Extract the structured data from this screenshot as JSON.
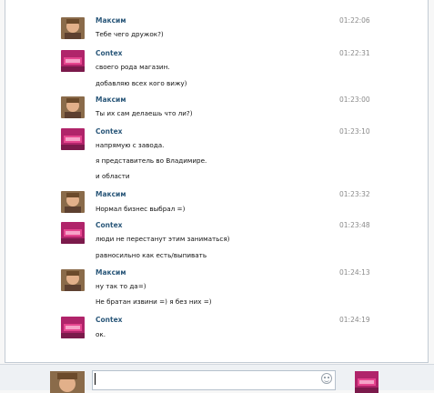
{
  "messages": [
    {
      "author": "Максим",
      "avatar": "maksim-avatar",
      "time": "01:22:06",
      "lines": [
        "Тебе чего дружок?)"
      ]
    },
    {
      "author": "Contex",
      "avatar": "contex-avatar",
      "time": "01:22:31",
      "lines": [
        "своего рода магазин.",
        "добавляю всех кого вижу)"
      ]
    },
    {
      "author": "Максим",
      "avatar": "maksim-avatar",
      "time": "01:23:00",
      "lines": [
        "Ты их сам делаешь что ли?)"
      ]
    },
    {
      "author": "Contex",
      "avatar": "contex-avatar",
      "time": "01:23:10",
      "lines": [
        "напрямую с завода.",
        "я представитель во Владимире.",
        "и области"
      ]
    },
    {
      "author": "Максим",
      "avatar": "maksim-avatar",
      "time": "01:23:32",
      "lines": [
        "Нормал бизнес выбрал =)"
      ]
    },
    {
      "author": "Contex",
      "avatar": "contex-avatar",
      "time": "01:23:48",
      "lines": [
        "люди не перестанут этим заниматься)",
        "равносильно как есть/выпивать"
      ]
    },
    {
      "author": "Максим",
      "avatar": "maksim-avatar",
      "time": "01:24:13",
      "lines": [
        "ну так то да=)",
        "Не братан извини =) я без них =)"
      ]
    },
    {
      "author": "Contex",
      "avatar": "contex-avatar",
      "time": "01:24:19",
      "lines": [
        "ок."
      ]
    }
  ],
  "composer": {
    "input_value": "",
    "input_placeholder": "",
    "emoji_icon": "smiley-icon"
  },
  "colors": {
    "author_name": "#2b587a",
    "timestamp": "#8a8a8a",
    "panel_border": "#c3cbd4"
  }
}
